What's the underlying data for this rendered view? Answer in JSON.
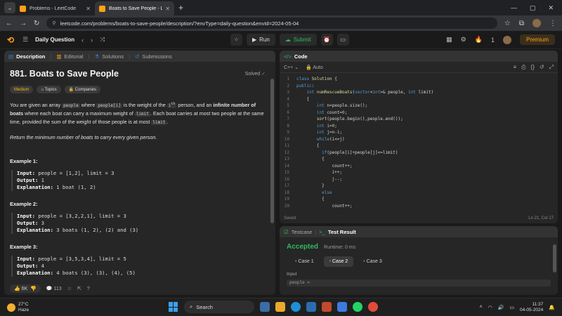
{
  "browser": {
    "tabs": [
      {
        "title": "Problems - LeetCode",
        "active": false
      },
      {
        "title": "Boats to Save People - LeetCode",
        "active": true
      }
    ],
    "url": "leetcode.com/problems/boats-to-save-people/description/?envType=daily-question&envId=2024-05-04"
  },
  "nav": {
    "daily_label": "Daily Question",
    "run_label": "Run",
    "submit_label": "Submit",
    "streak": "1",
    "premium_label": "Premium"
  },
  "left_tabs": [
    "Description",
    "Editorial",
    "Solutions",
    "Submissions"
  ],
  "problem": {
    "title": "881. Boats to Save People",
    "status": "Solved",
    "tags": [
      "Medium",
      "Topics",
      "Companies"
    ],
    "para1_a": "You are given an array ",
    "para1_code1": "people",
    "para1_b": " where ",
    "para1_code2": "people[i]",
    "para1_c": " is the weight of the ",
    "para1_sup": "th",
    "para1_d": " person, and an ",
    "para1_bold": "infinite number of boats",
    "para1_e": " where each boat can carry a maximum weight of ",
    "para1_code3": "limit",
    "para1_f": ". Each boat carries at most two people at the same time, provided the sum of the weight of those people is at most ",
    "para1_code4": "limit",
    "para1_g": ".",
    "para2": "Return the minimum number of boats to carry every given person.",
    "examples": [
      {
        "heading": "Example 1:",
        "input": "people = [1,2], limit = 3",
        "output": "1",
        "explanation": "1 boat (1, 2)"
      },
      {
        "heading": "Example 2:",
        "input": "people = [3,2,2,1], limit = 3",
        "output": "3",
        "explanation": "3 boats (1, 2), (2) and (3)"
      },
      {
        "heading": "Example 3:",
        "input": "people = [3,5,3,4], limit = 5",
        "output": "4",
        "explanation": "4 boats (3), (3), (4), (5)"
      }
    ],
    "labels": {
      "input": "Input:",
      "output": "Output:",
      "explanation": "Explanation:"
    },
    "likes": "6K",
    "comments": "113"
  },
  "code": {
    "header": "Code",
    "language": "C++",
    "mode": "Auto",
    "lines": [
      "class Solution {",
      "public:",
      "    int numRescueBoats(vector<int>& people, int limit)",
      "    {",
      "        int n=people.size();",
      "        int count=0;",
      "        sort(people.begin(),people.end());",
      "        int i=0;",
      "        int j=n-1;",
      "        while(i<=j)",
      "        {",
      "          if(people[i]+people[j]<=limit)",
      "          {",
      "              count++;",
      "              i++;",
      "              j--;",
      "          }",
      "          else",
      "          {",
      "              count++;"
    ],
    "saved_label": "Saved",
    "cursor": "Ln 21, Col 17"
  },
  "result": {
    "tab_testcase": "Testcase",
    "tab_result": "Test Result",
    "verdict": "Accepted",
    "runtime": "Runtime: 0 ms",
    "cases": [
      "Case 1",
      "Case 2",
      "Case 3"
    ],
    "selected_case": 1,
    "input_label": "Input",
    "input_value": "people ="
  },
  "taskbar": {
    "temp": "27°C",
    "weather": "Haze",
    "search": "Search",
    "time": "11:37",
    "date": "04-05-2024"
  },
  "colors": {
    "accent": "#ffa116",
    "success": "#2cbb5d",
    "link": "#2f7fd6"
  }
}
